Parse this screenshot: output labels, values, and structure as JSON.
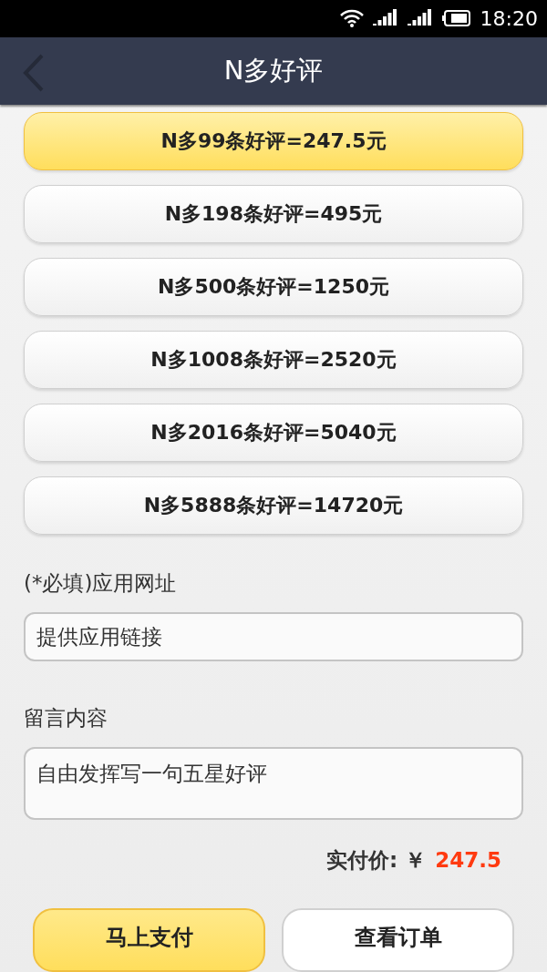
{
  "status_bar": {
    "time": "18:20"
  },
  "header": {
    "title": "N多好评"
  },
  "packages": [
    {
      "label": "N多99条好评=247.5元",
      "selected": true
    },
    {
      "label": "N多198条好评=495元",
      "selected": false
    },
    {
      "label": "N多500条好评=1250元",
      "selected": false
    },
    {
      "label": "N多1008条好评=2520元",
      "selected": false
    },
    {
      "label": "N多2016条好评=5040元",
      "selected": false
    },
    {
      "label": "N多5888条好评=14720元",
      "selected": false
    }
  ],
  "url_field": {
    "label": "(*必填)应用网址",
    "placeholder": "提供应用链接"
  },
  "message_field": {
    "label": "留言内容",
    "placeholder": "自由发挥写一句五星好评"
  },
  "total": {
    "label": "实付价: ￥",
    "amount": "247.5"
  },
  "buttons": [
    {
      "label": "马上支付",
      "kind": "primary"
    },
    {
      "label": "查看订单",
      "kind": "secondary"
    }
  ]
}
